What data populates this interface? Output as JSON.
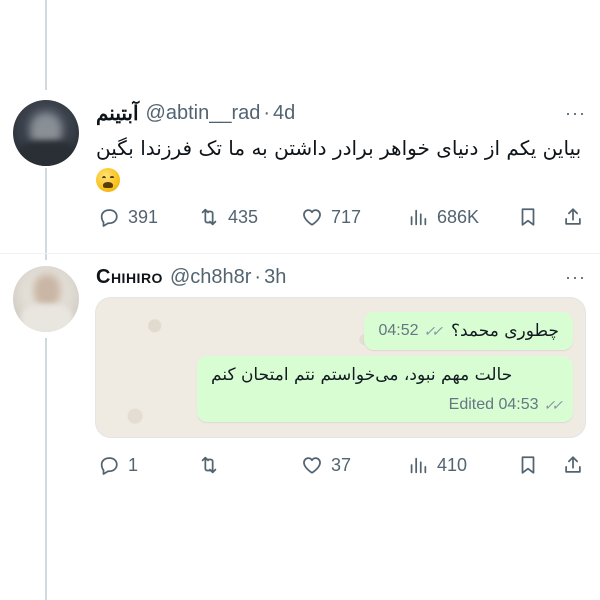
{
  "tweets": [
    {
      "display_name": "آبتینم",
      "handle": "@abtin__rad",
      "separator": "·",
      "time": "4d",
      "more": "···",
      "text": "بیاین یکم از دنیای خواهر برادر داشتن به ما تک فرزندا بگین",
      "emoji_icon": "weary-face-emoji",
      "actions": {
        "replies": "391",
        "retweets": "435",
        "likes": "717",
        "views": "686K"
      }
    },
    {
      "display_name": "Chihiro",
      "handle": "@ch8h8r",
      "separator": "·",
      "time": "3h",
      "more": "···",
      "chat": {
        "messages": [
          {
            "text": "چطوری محمد؟",
            "time": "04:52",
            "status_icon": "double-check-icon"
          },
          {
            "text": "حالت مهم نبود، می‌خواستم نتم امتحان کنم",
            "edited_time": "Edited 04:53",
            "status_icon": "double-check-icon"
          }
        ]
      },
      "actions": {
        "replies": "1",
        "retweets": "",
        "likes": "37",
        "views": "410"
      }
    }
  ],
  "colors": {
    "text_secondary": "#536471",
    "bubble_green": "#d9fdd3",
    "chat_background": "#efeae2"
  }
}
